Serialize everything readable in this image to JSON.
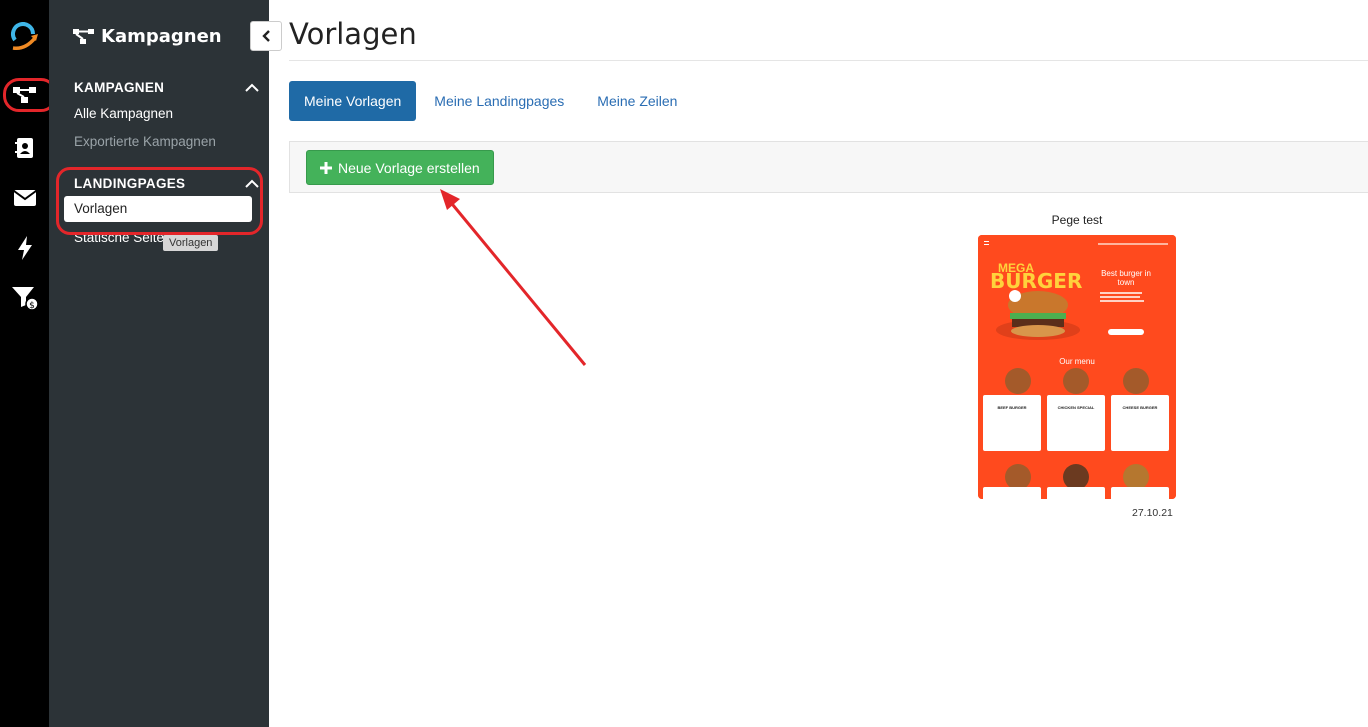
{
  "rail": {
    "icons": [
      "logo-icon",
      "campaign-tree-icon",
      "contacts-icon",
      "mail-icon",
      "bolt-icon",
      "funnel-money-icon"
    ]
  },
  "sidebar": {
    "title": "Kampagnen",
    "sections": [
      {
        "heading": "KAMPAGNEN",
        "items": [
          "Alle Kampagnen",
          "Exportierte Kampagnen"
        ]
      },
      {
        "heading": "LANDINGPAGES",
        "items": [
          "Vorlagen",
          "Statische Seiten"
        ]
      }
    ],
    "tooltip": "Vorlagen"
  },
  "main": {
    "title": "Vorlagen",
    "tabs": [
      {
        "label": "Meine Vorlagen",
        "active": true
      },
      {
        "label": "Meine Landingpages",
        "active": false
      },
      {
        "label": "Meine Zeilen",
        "active": false
      }
    ],
    "new_button": "Neue Vorlage erstellen"
  },
  "template": {
    "name": "Pege test",
    "date": "27.10.21",
    "preview": {
      "headline_small": "MEGA",
      "headline_big": "BURGER",
      "tagline": "Best burger in town",
      "menu_title": "Our menu",
      "items": [
        "BEEF BURGER",
        "CHICKEN SPECIAL",
        "CHEESE BURGER"
      ]
    }
  },
  "colors": {
    "rail": "#000000",
    "sidebar": "#2c3337",
    "tab_active": "#1f6aa6",
    "button_green": "#44b25a",
    "annotation_red": "#e3262a",
    "preview_orange": "#ff4a1e"
  }
}
